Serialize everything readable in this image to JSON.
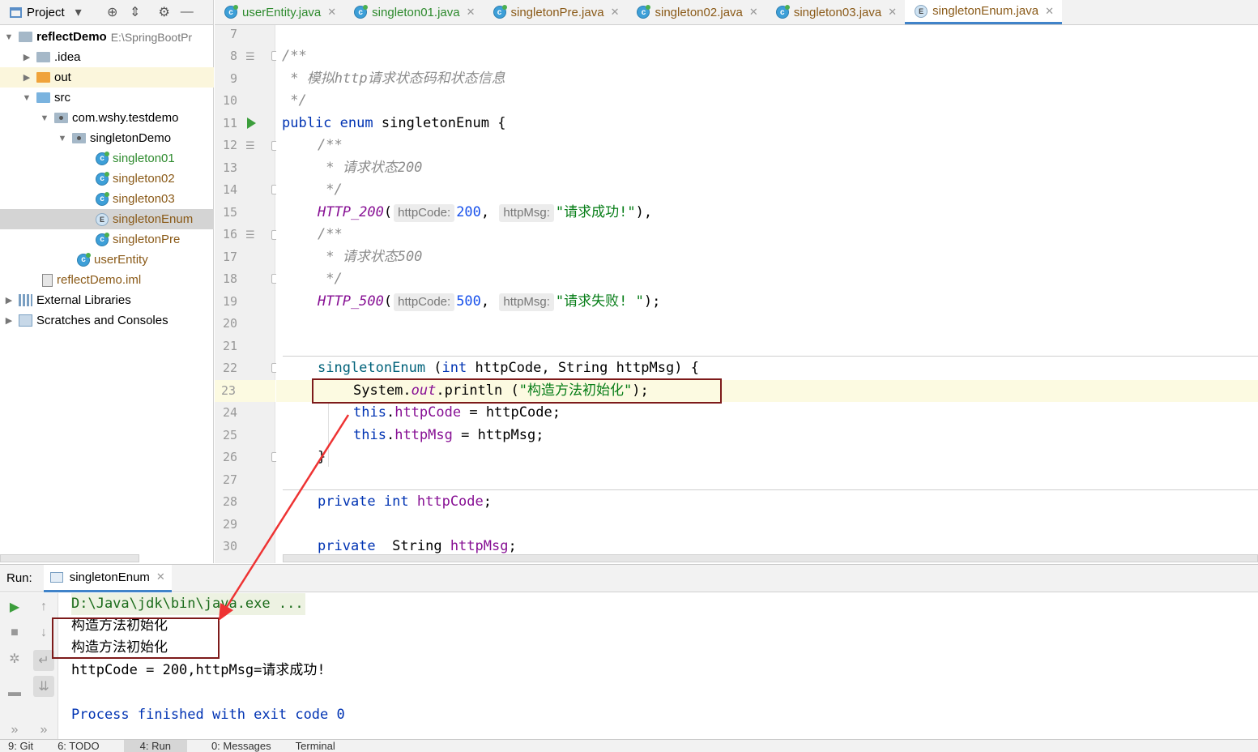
{
  "project_header": {
    "label": "Project"
  },
  "tabs": [
    {
      "label": "userEntity.java",
      "kind": "class"
    },
    {
      "label": "singleton01.java",
      "kind": "class"
    },
    {
      "label": "singletonPre.java",
      "kind": "class"
    },
    {
      "label": "singleton02.java",
      "kind": "class"
    },
    {
      "label": "singleton03.java",
      "kind": "class"
    },
    {
      "label": "singletonEnum.java",
      "kind": "enum",
      "active": true
    }
  ],
  "tree": {
    "root_name": "reflectDemo",
    "root_path": "E:\\SpringBootPr",
    "idea": ".idea",
    "out": "out",
    "src": "src",
    "package": "com.wshy.testdemo",
    "subpackage": "singletonDemo",
    "files": [
      "singleton01",
      "singleton02",
      "singleton03",
      "singletonEnum",
      "singletonPre"
    ],
    "user_entity": "userEntity",
    "iml": "reflectDemo.iml",
    "external_libraries": "External Libraries",
    "scratches": "Scratches and Consoles"
  },
  "editor": {
    "line_numbers": [
      "7",
      "8",
      "9",
      "10",
      "11",
      "12",
      "13",
      "14",
      "15",
      "16",
      "17",
      "18",
      "19",
      "20",
      "21",
      "22",
      "23",
      "24",
      "25",
      "26",
      "27",
      "28",
      "29",
      "30"
    ],
    "comment_class_open": "/**",
    "comment_class_body": " * 模拟http请求状态码和状态信息",
    "comment_close": " */",
    "kw_public": "public",
    "kw_enum": "enum",
    "class_name": "singletonEnum",
    "open_brace": "{",
    "c200_open": "/**",
    "c200_body": " * 请求状态200",
    "c200_close": " */",
    "http200": "HTTP_200",
    "hint_code": "httpCode:",
    "hint_msg": "httpMsg:",
    "val200": "200",
    "msg200": "\"请求成功!\"",
    "c500_open": "/**",
    "c500_body": " * 请求状态500",
    "c500_close": " */",
    "http500": "HTTP_500",
    "val500": "500",
    "msg500": "\"请求失败! \"",
    "ctor_name": "singletonEnum",
    "kw_int": "int",
    "p_httpCode": "httpCode",
    "kw_String": "String",
    "p_httpMsg": "httpMsg",
    "sys": "System.",
    "out_field": "out",
    "println": ".println (",
    "ctor_msg": "\"构造方法初始化\"",
    "kw_this": "this",
    "f_httpCode": "httpCode",
    "f_httpMsg": "httpMsg",
    "kw_private": "private"
  },
  "run": {
    "label": "Run:",
    "tab_label": "singletonEnum",
    "lines": [
      "D:\\Java\\jdk\\bin\\java.exe ...",
      "构造方法初始化",
      "构造方法初始化",
      "httpCode = 200,httpMsg=请求成功!",
      "",
      "Process finished with exit code 0"
    ]
  },
  "statusbar": {
    "items": [
      "9: Git",
      "6: TODO",
      "4: Run",
      "0: Messages",
      "Terminal"
    ]
  },
  "colors": {
    "accent": "#4083c9",
    "annotation": "#7d1a1a",
    "arrow": "#ee3333",
    "keyword": "#0033b3",
    "string": "#067d17"
  }
}
